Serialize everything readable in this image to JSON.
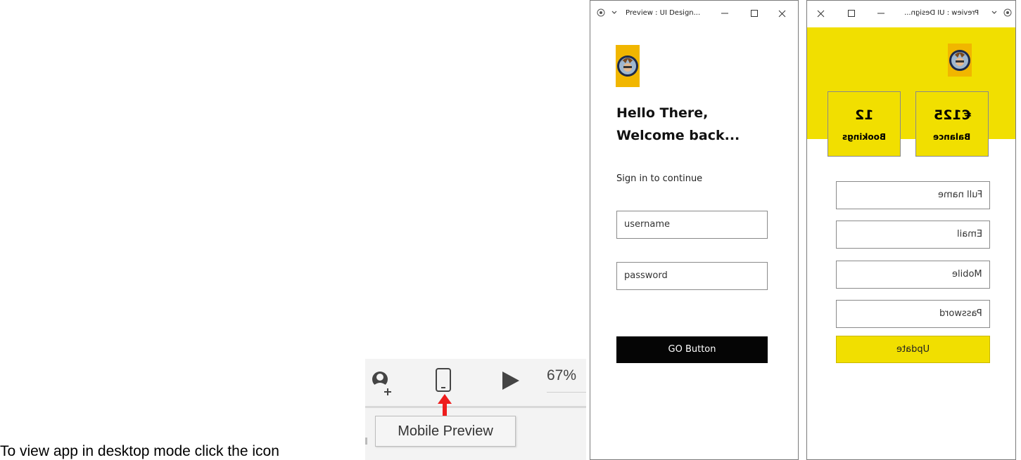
{
  "caption": {
    "text": "To view app in desktop mode click the icon"
  },
  "toolbar": {
    "zoom_label": "67%",
    "tooltip_label": "Mobile Preview",
    "icons": [
      "add-user-icon",
      "mobile-phone-icon",
      "play-icon",
      "red-arrow-up-icon"
    ]
  },
  "login_window": {
    "title": "Preview : UI Design...",
    "greeting_line1": "Hello There,",
    "greeting_line2": "Welcome back...",
    "subtitle": "Sign in to continue",
    "username_value": "username",
    "password_value": "password",
    "go_label": "GO Button"
  },
  "profile_window": {
    "title": "Preview : UI Design...",
    "balance_value": "€125",
    "balance_label": "Balance",
    "bookings_value": "12",
    "bookings_label": "Bookings",
    "fields": [
      "Full name",
      "Email",
      "Mobile",
      "Password"
    ],
    "update_label": "Update",
    "accent_color": "#f1df00"
  },
  "colors": {
    "accent_yellow": "#f1df00",
    "go_button_bg": "#050505",
    "arrow_red": "#ee1c1c"
  }
}
